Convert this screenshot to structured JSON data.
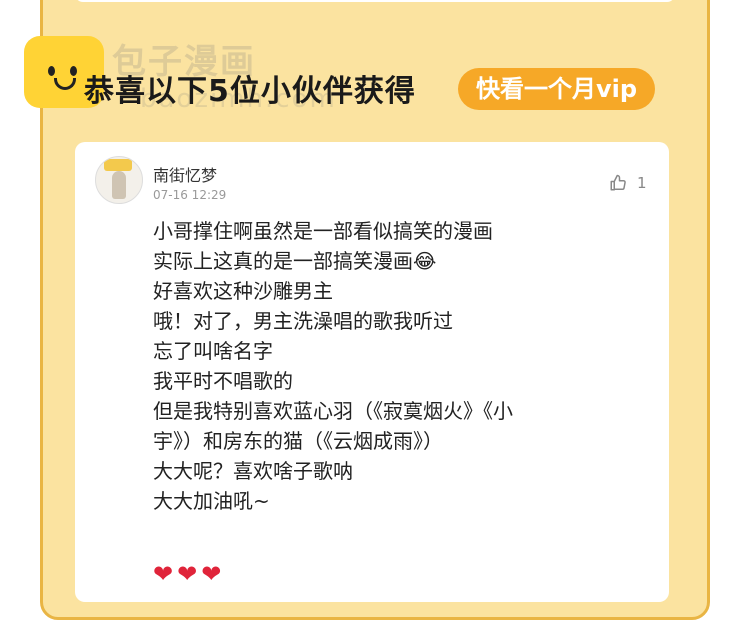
{
  "watermark": {
    "name": "包子漫画",
    "url": "baozimh.com"
  },
  "header": {
    "headline": "恭喜以下5位小伙伴获得",
    "reward_pill": "快看一个月vip"
  },
  "comment": {
    "username": "南街忆梦",
    "date": "07-16 12:29",
    "like_count": "1",
    "lines": [
      "小哥撑住啊虽然是一部看似搞笑的漫画",
      "实际上这真的是一部搞笑漫画😂",
      "好喜欢这种沙雕男主",
      "哦！对了，男主洗澡唱的歌我听过",
      "忘了叫啥名字",
      "我平时不唱歌的",
      "但是我特别喜欢蓝心羽（《寂寞烟火》《小",
      "宇》）和房东的猫（《云烟成雨》）",
      "大大呢？喜欢啥子歌呐",
      "大大加油吼~"
    ],
    "hearts": [
      "❤",
      "❤",
      "❤"
    ]
  },
  "colors": {
    "panel_bg": "#fbe3a0",
    "panel_border": "#e9b544",
    "pill_bg": "#f6a827",
    "heart": "#e0243a"
  }
}
